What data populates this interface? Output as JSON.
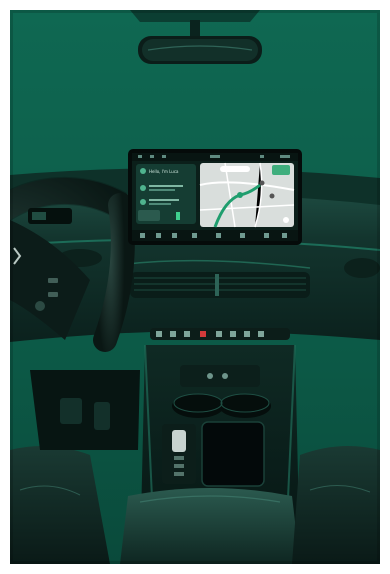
{
  "scene": {
    "subject": "car-interior-dashboard",
    "colors": {
      "background_wall": "#0f6650",
      "dashboard": "#12332c",
      "trim_accent": "#1f7a63",
      "screen_bg": "#0b1f1a",
      "map_bg": "#d9dedc",
      "route": "#1f9e6e"
    }
  },
  "infotainment": {
    "nav_card_text": "Hello, I'm Luca"
  }
}
